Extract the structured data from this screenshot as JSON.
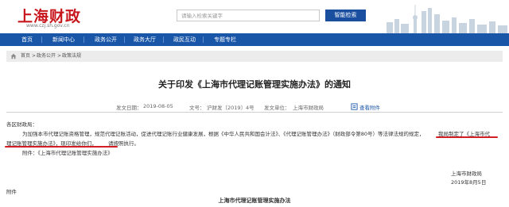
{
  "header": {
    "logo_text": "上海财政",
    "logo_url": "www.czj.sh.gov.cn",
    "search_placeholder": "请输入检索关键字",
    "search_button": "智能检索"
  },
  "nav": {
    "items": [
      {
        "label": "首页"
      },
      {
        "label": "新闻中心"
      },
      {
        "label": "政务公开"
      },
      {
        "label": "政务大厅"
      },
      {
        "label": "政民互动"
      },
      {
        "label": "专题专栏"
      }
    ]
  },
  "breadcrumb": {
    "items": [
      "首页",
      "政务公开",
      "政策法规"
    ],
    "separator": ">"
  },
  "article": {
    "title": "关于印发《上海市代理记账管理实施办法》的通知",
    "meta": {
      "date_label": "发文日期：",
      "date": "2019-08-05",
      "docno_label": "文号：",
      "docno": "沪财发〔2019〕4号",
      "org_label": "发文单位：",
      "org": "上海市财政局",
      "view_attachment": "查看附件"
    },
    "salutation": "各区财政局：",
    "para_line1": "为加强本市代理记账资格管理，规范代理记账活动，促进代理记账行业健康发展，根据《中华人民共和国会计法》、《代理记账管理办法》（财政部令第80号）等法律法规的规定，",
    "para_line1_tail": "我局制定了《上海市代",
    "para_line2_a": "理记账管理实施办法》，现印发给你们，",
    "para_line2_b": "请按照执行。",
    "attachment_line": "附件：《上海市代理记账管理实施办法》",
    "signature_org": "上海市财政局",
    "signature_date": "2019年8月5日",
    "attachment_heading": "附件",
    "attachment_title": "上海市代理记账管理实施办法"
  },
  "colors": {
    "brand_red": "#c8161d",
    "nav_blue": "#1a56a8",
    "search_blue": "#1a4fa0",
    "annotation_red": "#d21e23"
  }
}
